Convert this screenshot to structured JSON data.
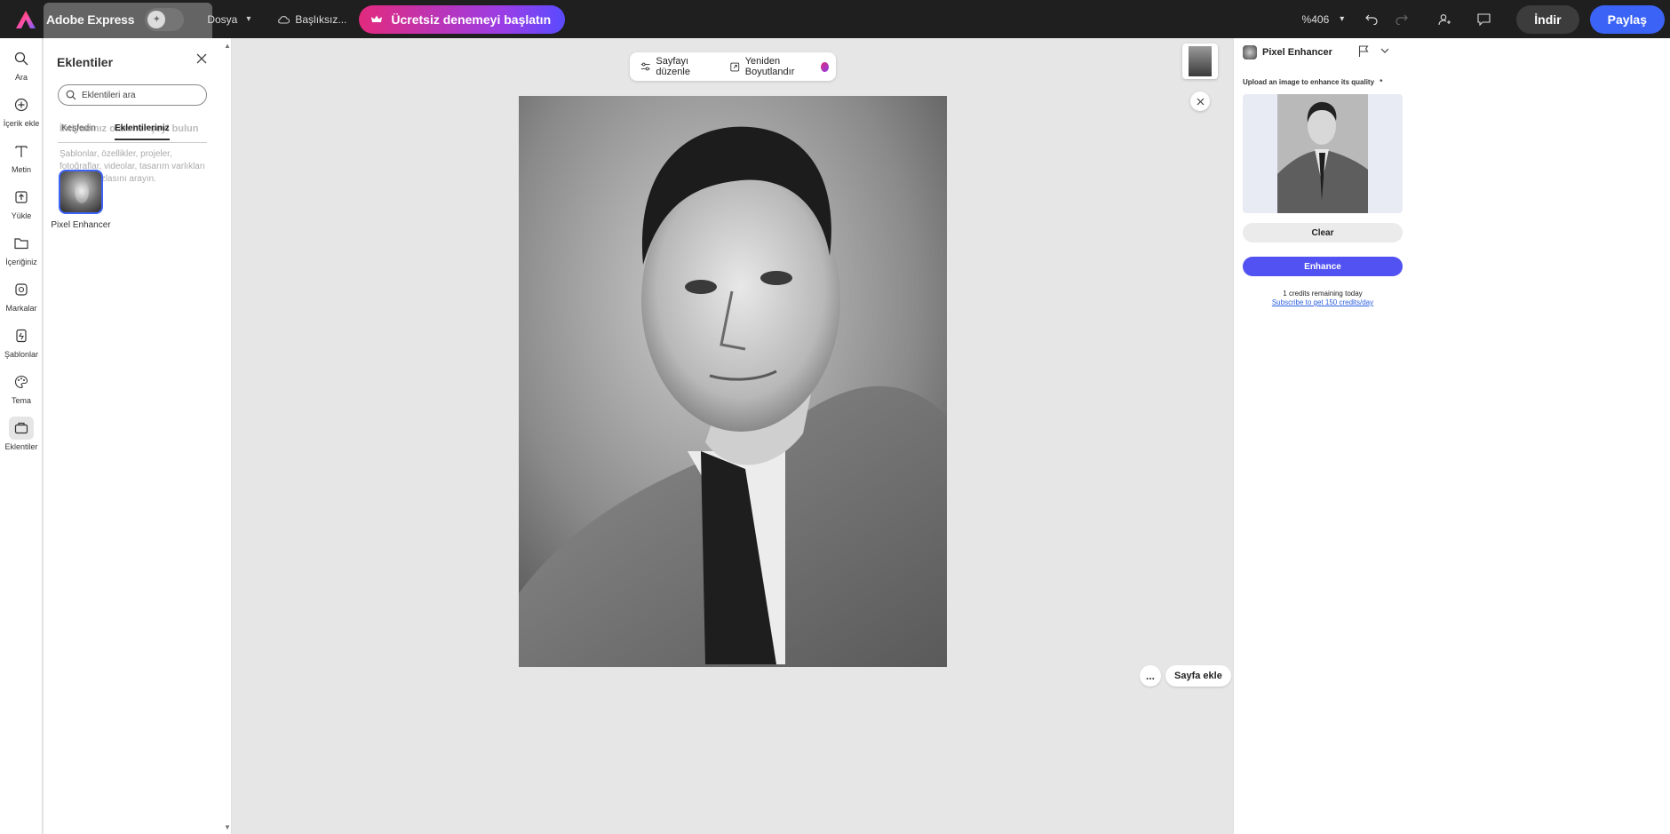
{
  "app": {
    "name": "Adobe Express",
    "file_menu": "Dosya",
    "document_name": "Başlıksız...",
    "trial_button": "Ücretsiz denemeyi başlatın",
    "zoom": "%406",
    "download": "İndir",
    "share": "Paylaş"
  },
  "rail": {
    "items": [
      {
        "label": "Ara",
        "icon": "search-icon"
      },
      {
        "label": "İçerik ekle",
        "icon": "add-circle-icon"
      },
      {
        "label": "Metin",
        "icon": "text-icon"
      },
      {
        "label": "Yükle",
        "icon": "upload-icon"
      },
      {
        "label": "İçeriğiniz",
        "icon": "folder-icon"
      },
      {
        "label": "Markalar",
        "icon": "brand-icon"
      },
      {
        "label": "Şablonlar",
        "icon": "templates-icon"
      },
      {
        "label": "Tema",
        "icon": "palette-icon"
      },
      {
        "label": "Eklentiler",
        "icon": "addons-icon"
      }
    ]
  },
  "plugins_panel": {
    "title": "Eklentiler",
    "search_placeholder": "Eklentileri ara",
    "tabs": [
      "Keşfedin",
      "Eklentileriniz"
    ],
    "ghost_heading": "İhtiyacınız olan her şeyi bulun",
    "description": "Şablonlar, özellikler, projeler, fotoğraflar, videolar, tasarım varlıkları ve daha fazlasını arayın.",
    "installed": [
      {
        "name": "Pixel Enhancer"
      }
    ]
  },
  "canvas": {
    "edit_page": "Sayfayı düzenle",
    "resize": "Yeniden Boyutlandır",
    "add_page": "Sayfa ekle",
    "more": "..."
  },
  "right_panel": {
    "title": "Pixel Enhancer",
    "upload_label": "Upload an image to enhance its quality",
    "required_mark": "*",
    "clear": "Clear",
    "enhance": "Enhance",
    "credits": "1 credits remaining today",
    "subscribe": "Subscribe to get 150 credits/day"
  },
  "colors": {
    "topbar": "#1f1f1f",
    "share": "#3b63f6",
    "enhance": "#5252f2",
    "trial_gradient_start": "#e22a7d",
    "trial_gradient_end": "#5a4bff"
  }
}
